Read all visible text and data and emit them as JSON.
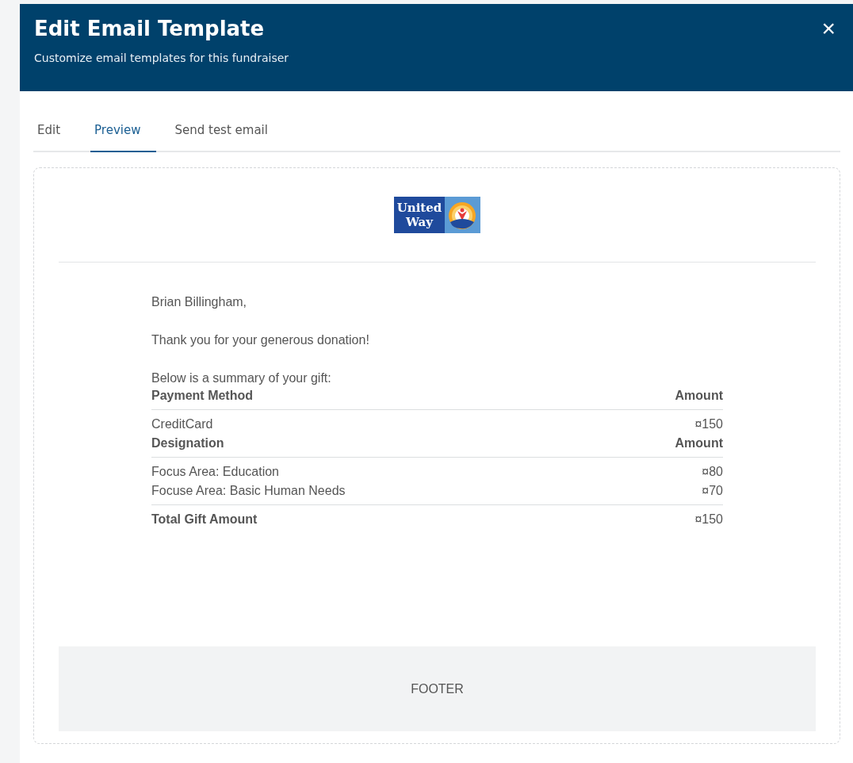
{
  "dialog": {
    "title": "Edit Email Template",
    "subtitle": "Customize email templates for this fundraiser",
    "close": "×"
  },
  "tabs": [
    {
      "label": "Edit",
      "selected": false
    },
    {
      "label": "Preview",
      "selected": true
    },
    {
      "label": "Send test email",
      "selected": false
    }
  ],
  "preview": {
    "logo": {
      "line1": "United",
      "line2": "Way"
    },
    "greeting": "Brian Billingham,",
    "thanks": "Thank you for your generous donation!",
    "summary_intro": "Below is a summary of your gift:",
    "sections": [
      {
        "heading": "Payment Method",
        "amount_heading": "Amount",
        "rows": [
          {
            "label": "CreditCard",
            "amount": "¤150"
          }
        ]
      },
      {
        "heading": "Designation",
        "amount_heading": "Amount",
        "rows": [
          {
            "label": "Focus Area: Education",
            "amount": "¤80"
          },
          {
            "label": "Focuse Area: Basic Human Needs",
            "amount": "¤70"
          }
        ]
      }
    ],
    "total": {
      "label": "Total Gift Amount",
      "amount": "¤150"
    },
    "footer": "FOOTER"
  }
}
